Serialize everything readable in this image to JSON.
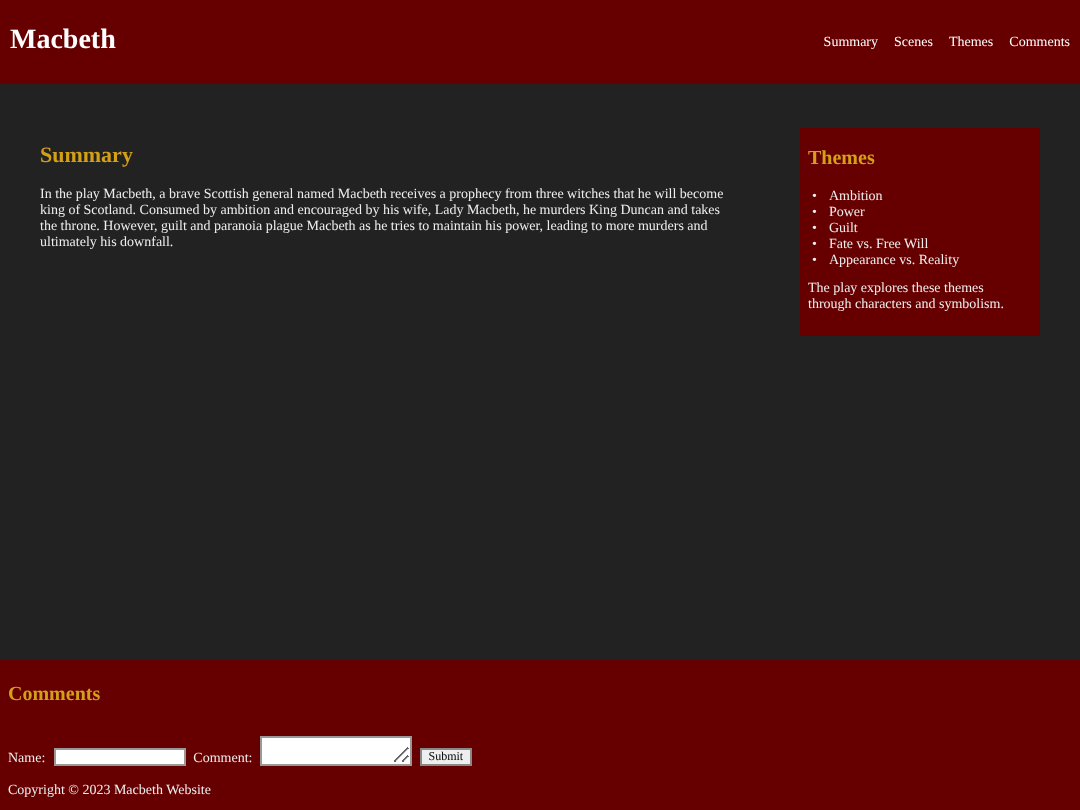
{
  "header": {
    "title": "Macbeth",
    "nav": [
      {
        "label": "Summary"
      },
      {
        "label": "Scenes"
      },
      {
        "label": "Themes"
      },
      {
        "label": "Comments"
      }
    ]
  },
  "summary": {
    "heading": "Summary",
    "text": "In the play Macbeth, a brave Scottish general named Macbeth receives a prophecy from three witches that he will become king of Scotland. Consumed by ambition and encouraged by his wife, Lady Macbeth, he murders King Duncan and takes the throne. However, guilt and paranoia plague Macbeth as he tries to maintain his power, leading to more murders and ultimately his downfall."
  },
  "themes": {
    "heading": "Themes",
    "items": [
      {
        "marker": "•",
        "label": "Ambition"
      },
      {
        "marker": "•",
        "label": "Power"
      },
      {
        "marker": "•",
        "label": "Guilt"
      },
      {
        "marker": "•",
        "label": "Fate vs. Free Will"
      },
      {
        "marker": "•",
        "label": "Appearance vs. Reality"
      }
    ],
    "note": "The play explores these themes through characters and symbolism."
  },
  "comments": {
    "heading": "Comments",
    "name_label": "Name:",
    "comment_label": "Comment:",
    "submit": "Submit"
  },
  "footer": {
    "copyright": "Copyright © 2023 Macbeth Website"
  }
}
